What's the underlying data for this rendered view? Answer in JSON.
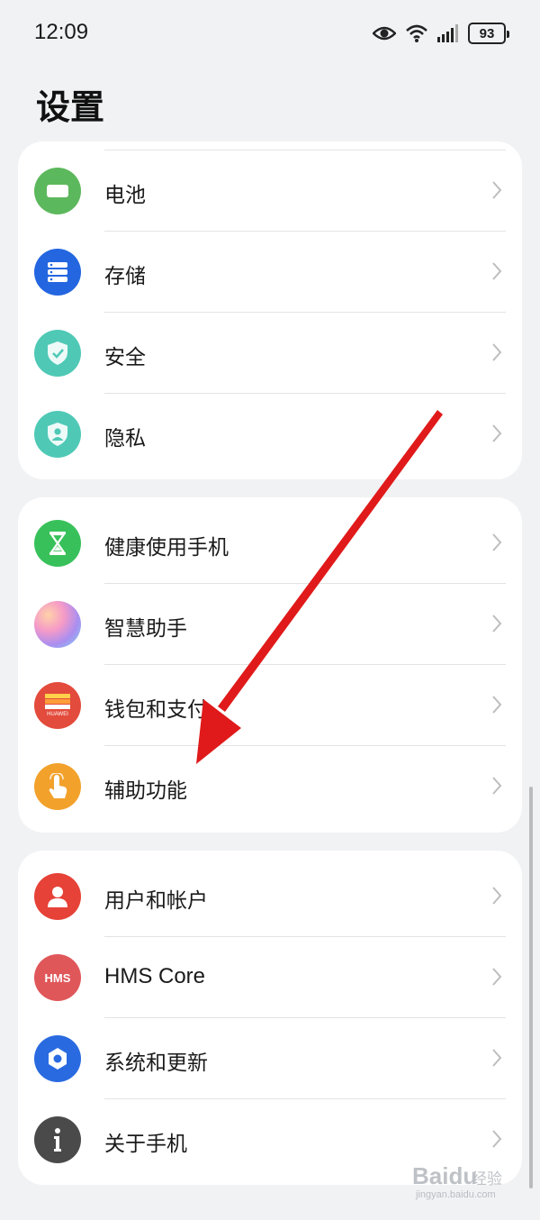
{
  "status_bar": {
    "time": "12:09",
    "battery": "93"
  },
  "page": {
    "title": "设置"
  },
  "groups": [
    {
      "items": [
        {
          "label": "电池",
          "icon": "battery-icon",
          "color": "#5cb85c"
        },
        {
          "label": "存储",
          "icon": "storage-icon",
          "color": "#2466e0"
        },
        {
          "label": "安全",
          "icon": "security-shield-icon",
          "color": "#4fc9b6"
        },
        {
          "label": "隐私",
          "icon": "privacy-shield-icon",
          "color": "#4fc9b6"
        }
      ]
    },
    {
      "items": [
        {
          "label": "健康使用手机",
          "icon": "hourglass-icon",
          "color": "#38c15a"
        },
        {
          "label": "智慧助手",
          "icon": "assistant-orb-icon",
          "color": "#c79be3"
        },
        {
          "label": "钱包和支付",
          "icon": "huawei-wallet-icon",
          "color": "#e34b3c",
          "icon_text": "HUAWEI"
        },
        {
          "label": "辅助功能",
          "icon": "accessibility-hand-icon",
          "color": "#f2a12b"
        }
      ]
    },
    {
      "items": [
        {
          "label": "用户和帐户",
          "icon": "user-icon",
          "color": "#e64237"
        },
        {
          "label": "HMS Core",
          "icon": "hms-icon",
          "color": "#e0575a",
          "icon_text": "HMS"
        },
        {
          "label": "系统和更新",
          "icon": "system-gear-icon",
          "color": "#2a6ae0"
        },
        {
          "label": "关于手机",
          "icon": "info-icon",
          "color": "#4a4a4a"
        }
      ]
    }
  ],
  "watermark": {
    "logo": "Baidu",
    "text": "经验",
    "url": "jingyan.baidu.com"
  },
  "annotation": {
    "arrow_color": "#e01a1a"
  }
}
